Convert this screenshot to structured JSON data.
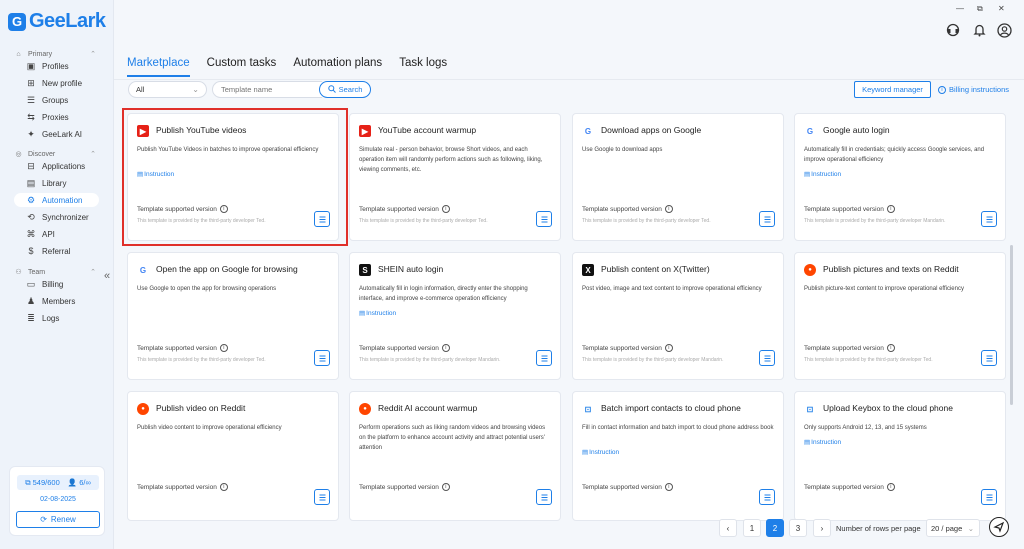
{
  "app": {
    "name": "GeeLark",
    "logo_letter": "G",
    "accent": "#1e7fe8"
  },
  "sidebar": {
    "groups": [
      {
        "label": "Primary",
        "icon": "home-icon"
      },
      {
        "label": "Discover",
        "icon": "compass-icon"
      },
      {
        "label": "Team",
        "icon": "team-icon"
      }
    ],
    "items": [
      {
        "label": "Profiles",
        "icon": "profiles-icon"
      },
      {
        "label": "New profile",
        "icon": "new-profile-icon"
      },
      {
        "label": "Groups",
        "icon": "groups-icon"
      },
      {
        "label": "Proxies",
        "icon": "proxies-icon"
      },
      {
        "label": "GeeLark AI",
        "icon": "ai-icon"
      },
      {
        "label": "Applications",
        "icon": "applications-icon"
      },
      {
        "label": "Library",
        "icon": "library-icon"
      },
      {
        "label": "Automation",
        "icon": "automation-icon",
        "active": true
      },
      {
        "label": "Synchronizer",
        "icon": "synchronizer-icon"
      },
      {
        "label": "API",
        "icon": "api-icon"
      },
      {
        "label": "Referral",
        "icon": "referral-icon"
      },
      {
        "label": "Billing",
        "icon": "billing-icon"
      },
      {
        "label": "Members",
        "icon": "members-icon"
      },
      {
        "label": "Logs",
        "icon": "logs-icon"
      }
    ],
    "quota": {
      "profiles": "549/600",
      "members": "6/∞"
    },
    "expiry_date": "02-08-2025",
    "renew_label": "Renew"
  },
  "tabs": [
    {
      "label": "Marketplace",
      "active": true
    },
    {
      "label": "Custom tasks"
    },
    {
      "label": "Automation plans"
    },
    {
      "label": "Task logs"
    }
  ],
  "filter": {
    "category_value": "All",
    "search_placeholder": "Template name",
    "search_label": "Search",
    "keyword_manager_label": "Keyword manager",
    "billing_instructions_label": "Billing instructions"
  },
  "card_common": {
    "supported_version_label": "Template supported version",
    "instruction_label": "Instruction"
  },
  "cards": [
    {
      "title": "Publish YouTube videos",
      "icon": "youtube-icon",
      "desc": "Publish YouTube Videos in batches to improve operational efficiency",
      "instruction": true,
      "provider": "This template is provided by the third-party developer Ted."
    },
    {
      "title": "YouTube account warmup",
      "icon": "youtube-icon",
      "desc": "Simulate real - person behavior, browse Short videos, and each operation item will randomly perform actions such as following, liking, viewing comments, etc.",
      "instruction": false,
      "provider": "This template is provided by the third-party developer Ted."
    },
    {
      "title": "Download apps on Google",
      "icon": "google-icon",
      "desc": "Use Google to download apps",
      "instruction": false,
      "provider": "This template is provided by the third-party developer Ted."
    },
    {
      "title": "Google auto login",
      "icon": "google-icon",
      "desc": "Automatically fill in credentials; quickly access Google services, and improve operational efficiency",
      "instruction": true,
      "provider": "This template is provided by the third-party developer Mandarin."
    },
    {
      "title": "Open the app on Google for browsing",
      "icon": "google-icon",
      "desc": "Use Google to open the app for browsing operations",
      "instruction": false,
      "provider": "This template is provided by the third-party developer Ted."
    },
    {
      "title": "SHEIN auto login",
      "icon": "shein-icon",
      "desc": "Automatically fill in login information, directly enter the shopping interface, and improve e-commerce operation efficiency",
      "instruction": true,
      "provider": "This template is provided by the third-party developer Mandarin."
    },
    {
      "title": "Publish content on X(Twitter)",
      "icon": "x-twitter-icon",
      "desc": "Post video, image and text content to improve operational efficiency",
      "instruction": false,
      "provider": "This template is provided by the third-party developer Mandarin."
    },
    {
      "title": "Publish pictures and texts on Reddit",
      "icon": "reddit-icon",
      "desc": "Publish picture-text content to improve operational efficiency",
      "instruction": false,
      "provider": "This template is provided by the third-party developer Ted."
    },
    {
      "title": "Publish video on Reddit",
      "icon": "reddit-icon",
      "desc": "Publish video content to improve operational efficiency",
      "instruction": false,
      "provider": ""
    },
    {
      "title": "Reddit AI account warmup",
      "icon": "reddit-icon",
      "desc": "Perform operations such as liking random videos and browsing videos on the platform to enhance account activity and attract potential users' attention",
      "instruction": false,
      "provider": ""
    },
    {
      "title": "Batch import contacts to cloud phone",
      "icon": "contacts-icon",
      "desc": "Fill in contact information and batch import to cloud phone address book",
      "instruction": true,
      "provider": ""
    },
    {
      "title": "Upload Keybox to the cloud phone",
      "icon": "keybox-icon",
      "desc": "Only supports Android 12, 13, and 15 systems",
      "instruction": true,
      "provider": ""
    }
  ],
  "pagination": {
    "pages": [
      "1",
      "2",
      "3"
    ],
    "current": "2",
    "rows_label": "Number of rows per page",
    "rows_value": "20 / page"
  }
}
